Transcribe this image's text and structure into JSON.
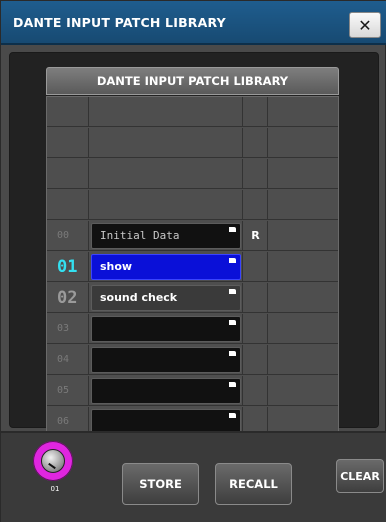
{
  "window": {
    "title": "DANTE INPUT PATCH LIBRARY"
  },
  "library": {
    "header": "DANTE INPUT PATCH LIBRARY",
    "rows": [
      {
        "num": "00",
        "name": "Initial Data",
        "flag": "R"
      },
      {
        "num": "01",
        "name": "show",
        "flag": ""
      },
      {
        "num": "02",
        "name": "sound check",
        "flag": ""
      },
      {
        "num": "03",
        "name": "",
        "flag": ""
      },
      {
        "num": "04",
        "name": "",
        "flag": ""
      },
      {
        "num": "05",
        "name": "",
        "flag": ""
      },
      {
        "num": "06",
        "name": "",
        "flag": ""
      }
    ]
  },
  "bottom": {
    "knob_label": "01",
    "store_label": "STORE",
    "recall_label": "RECALL",
    "clear_label": "CLEAR"
  },
  "colors": {
    "titlebar": "#1f5d8e",
    "selected_row": "#0a10d8",
    "current_number": "#33e0f0",
    "knob": "#e026e0"
  },
  "icons": {
    "close": "close-icon",
    "edit": "edit-name-icon",
    "knob": "knob-icon"
  }
}
